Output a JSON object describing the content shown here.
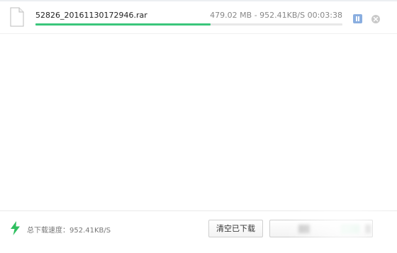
{
  "download": {
    "filename": "52826_20161130172946.rar",
    "stats": "479.02 MB - 952.41KB/S 00:03:38",
    "progress": 0.57,
    "icons": {
      "file": "document-icon",
      "pause": "pause-icon",
      "cancel": "close-circle-icon"
    }
  },
  "footer": {
    "speed_label": "总下载速度：952.41KB/S",
    "clear_button": "清空已下载",
    "second_button": "",
    "icons": {
      "speed": "lightning-icon"
    }
  },
  "colors": {
    "progress": "#3ac67b",
    "pause_button": "#8aaee0",
    "lightning": "#2fbf5f"
  }
}
